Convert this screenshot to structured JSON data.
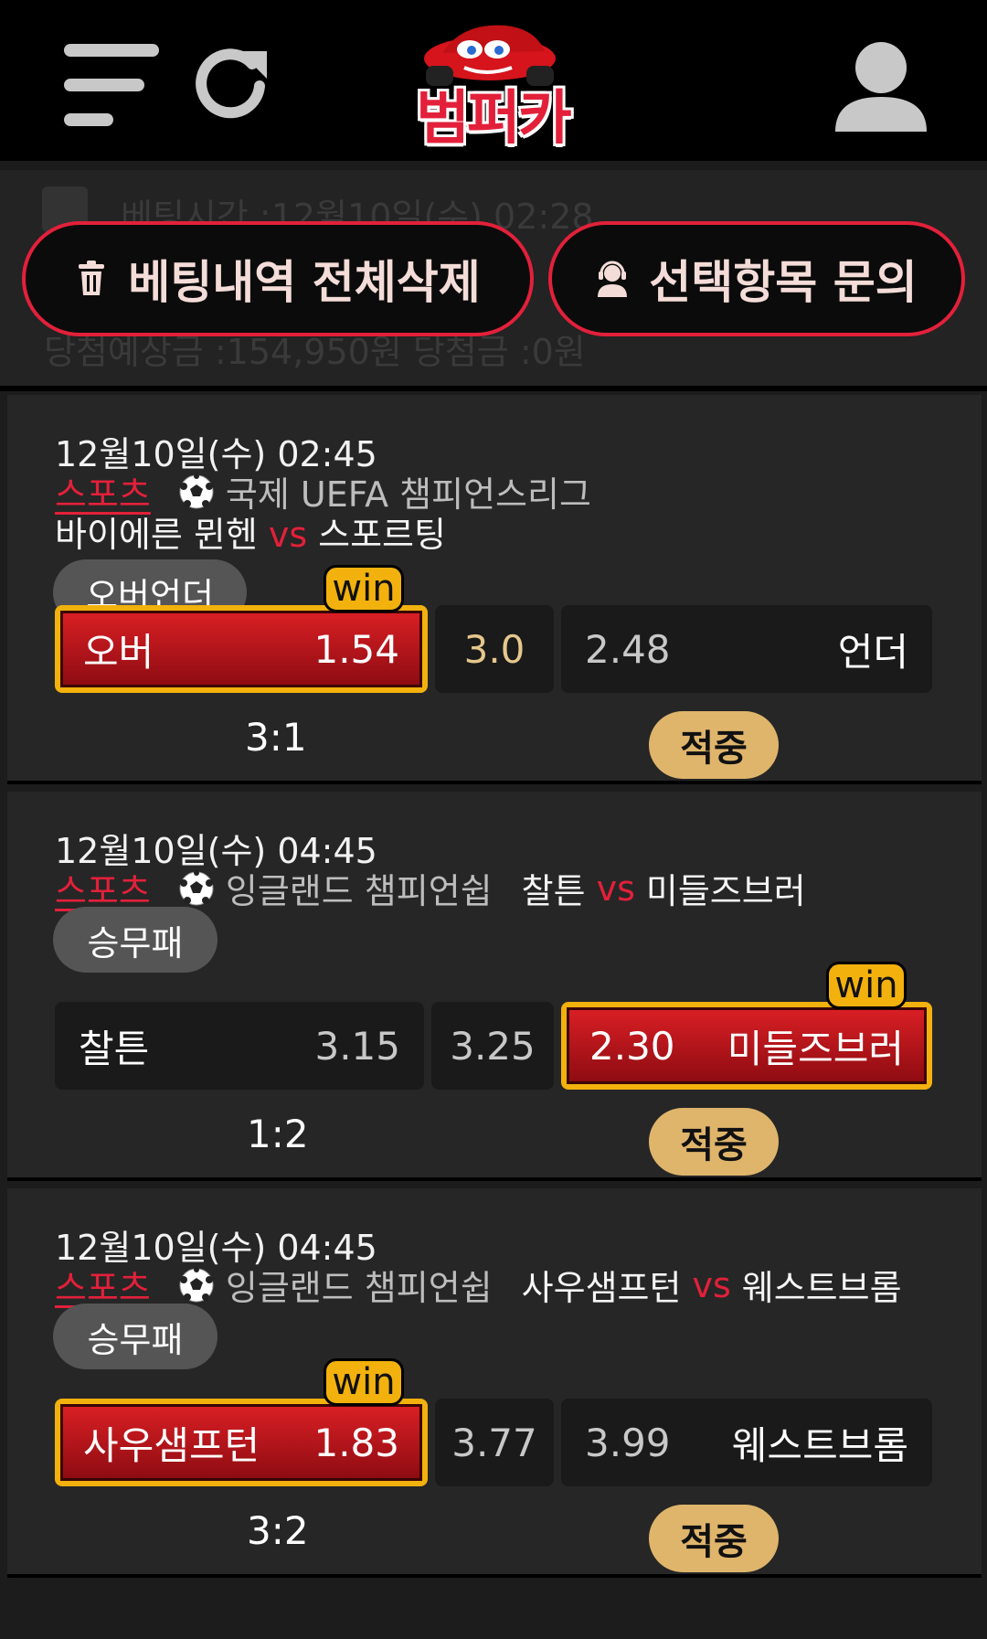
{
  "header": {
    "logo_text": "범퍼카",
    "menu_icon": "hamburger-menu-icon",
    "refresh_icon": "refresh-icon",
    "user_icon": "user-icon"
  },
  "summary": {
    "bet_time_text": "베팅시간 :12월10일(수) 02:28",
    "amount_text": "당첨예상금 :154,950원   당첨금 :0원",
    "delete_all_label": "베팅내역 전체삭제",
    "inquiry_label": "선택항목 문의"
  },
  "colors": {
    "accent_red": "#e3203a",
    "win_gold": "#f2b10d",
    "hit_badge": "#dfb56c"
  },
  "bets": [
    {
      "date": "12월10일(수) 02:45",
      "sport": "스포츠",
      "league": "국제 UEFA 챔피언스리그",
      "home": "바이에른 뮌헨",
      "vs": "vs",
      "away": "스포르팅",
      "market": "오버언더",
      "left_label": "오버",
      "left_odd": "1.54",
      "mid_value": "3.0",
      "right_odd": "2.48",
      "right_label": "언더",
      "win_label": "win",
      "score": "3:1",
      "result": "적중"
    },
    {
      "date": "12월10일(수) 04:45",
      "sport": "스포츠",
      "league": "잉글랜드 챔피언쉽",
      "home": "찰튼",
      "vs": "vs",
      "away": "미들즈브러",
      "market": "승무패",
      "left_label": "찰튼",
      "left_odd": "3.15",
      "mid_value": "3.25",
      "right_odd": "2.30",
      "right_label": "미들즈브러",
      "win_label": "win",
      "score": "1:2",
      "result": "적중"
    },
    {
      "date": "12월10일(수) 04:45",
      "sport": "스포츠",
      "league": "잉글랜드 챔피언쉽",
      "home": "사우샘프턴",
      "vs": "vs",
      "away": "웨스트브롬",
      "market": "승무패",
      "left_label": "사우샘프턴",
      "left_odd": "1.83",
      "mid_value": "3.77",
      "right_odd": "3.99",
      "right_label": "웨스트브롬",
      "win_label": "win",
      "score": "3:2",
      "result": "적중"
    }
  ]
}
